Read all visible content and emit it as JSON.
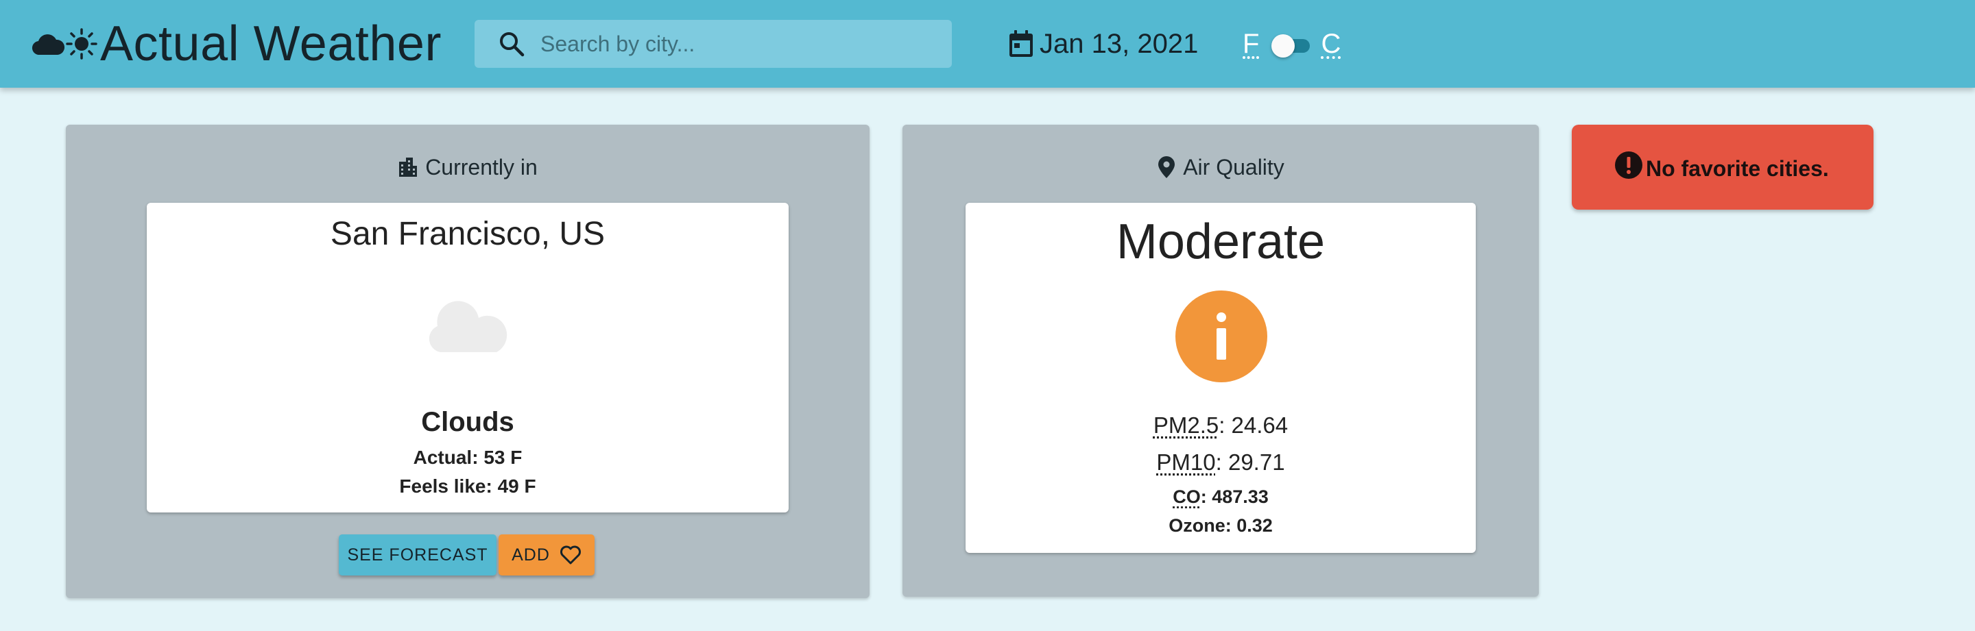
{
  "header": {
    "title": "Actual Weather",
    "logo_icons": [
      "cloud-icon",
      "sun-icon"
    ],
    "search": {
      "placeholder": "Search by city...",
      "value": "",
      "icon": "search-icon"
    },
    "date": {
      "icon": "calendar-icon",
      "text": "Jan 13, 2021"
    },
    "units": {
      "left": "F",
      "right": "C",
      "selected": "F"
    }
  },
  "current": {
    "heading_icon": "building-icon",
    "heading": "Currently in",
    "city": "San Francisco, US",
    "weather_icon": "cloud-icon",
    "condition": "Clouds",
    "actual": "Actual: 53 F",
    "feels_like": "Feels like: 49 F",
    "buttons": {
      "forecast": "SEE FORECAST",
      "add": "ADD",
      "add_icon": "heart-outline-icon"
    }
  },
  "air_quality": {
    "heading_icon": "location-pin-icon",
    "heading": "Air Quality",
    "level": "Moderate",
    "level_icon": "info-icon",
    "pm25_label": "PM2.5",
    "pm25_value": ": 24.64",
    "pm10_label": "PM10",
    "pm10_value": ": 29.71",
    "co_label": "CO",
    "co_value": ": 487.33",
    "ozone": "Ozone: 0.32"
  },
  "favorites": {
    "icon": "exclamation-icon",
    "message": "No favorite cities."
  },
  "colors": {
    "appbar": "#54b9d1",
    "background": "#e3f4f8",
    "panel": "#b1bdc3",
    "accent_orange": "#f2963a",
    "alert_red": "#e55441"
  }
}
